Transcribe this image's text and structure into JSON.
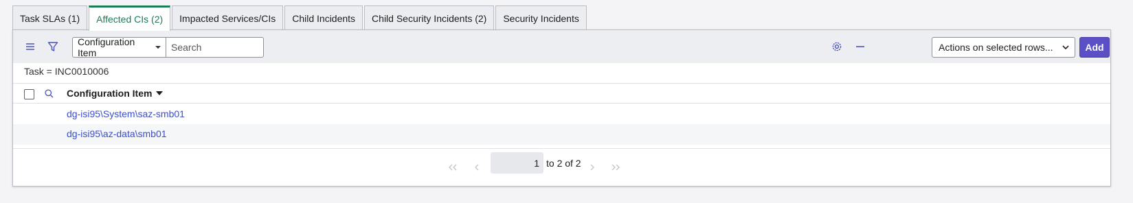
{
  "tabs": [
    {
      "label": "Task SLAs (1)"
    },
    {
      "label": "Affected CIs (2)"
    },
    {
      "label": "Impacted Services/CIs"
    },
    {
      "label": "Child Incidents"
    },
    {
      "label": "Child Security Incidents (2)"
    },
    {
      "label": "Security Incidents"
    }
  ],
  "active_tab": "Affected CIs (2)",
  "toolbar": {
    "field_select": "Configuration Item",
    "search_placeholder": "Search",
    "actions_select": "Actions on selected rows...",
    "add_label": "Add"
  },
  "breadcrumb": "Task = INC0010006",
  "table": {
    "column": "Configuration Item",
    "rows": [
      {
        "configuration_item": "dg-isi95\\System\\saz-smb01"
      },
      {
        "configuration_item": "dg-isi95\\az-data\\smb01"
      }
    ]
  },
  "pagination": {
    "page": "1",
    "info": "to 2 of 2"
  },
  "colors": {
    "accent": "#1a7d54",
    "button": "#5a4fc5",
    "link": "#3b4ec9"
  }
}
